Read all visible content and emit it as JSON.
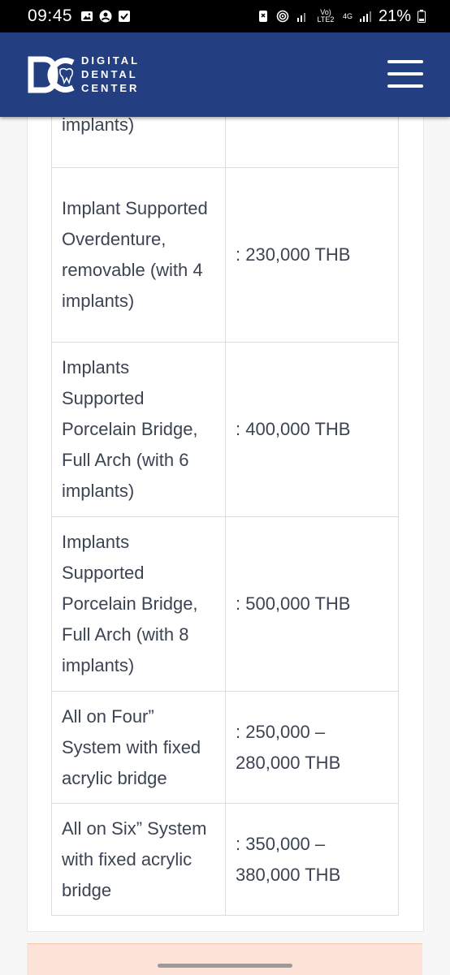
{
  "status_bar": {
    "time": "09:45",
    "battery": "21%",
    "network_lte": "Vo) LTE2",
    "network_4g": "4G"
  },
  "header": {
    "logo_letters": "DC",
    "logo_line1": "DIGITAL",
    "logo_line2": "DENTAL",
    "logo_line3": "CENTER"
  },
  "price_table": {
    "rows": [
      {
        "service": "implants)",
        "price": ""
      },
      {
        "service": "Implant Supported Overdenture, removable (with 4 implants)",
        "price": ": 230,000 THB"
      },
      {
        "service": "Implants Supported Porcelain Bridge, Full Arch (with 6 implants)",
        "price": ": 400,000 THB"
      },
      {
        "service": "Implants Supported Porcelain Bridge, Full Arch (with 8 implants)",
        "price": ": 500,000 THB"
      },
      {
        "service": "All on Four” System with fixed acrylic bridge",
        "price": ": 250,000 – 280,000 THB"
      },
      {
        "service": "All on Six” System with fixed acrylic bridge",
        "price": ": 350,000 – 380,000 THB"
      }
    ]
  },
  "colors": {
    "header_bg": "#233f82",
    "text": "#3c4452",
    "promo_bg": "#fde3d7"
  }
}
